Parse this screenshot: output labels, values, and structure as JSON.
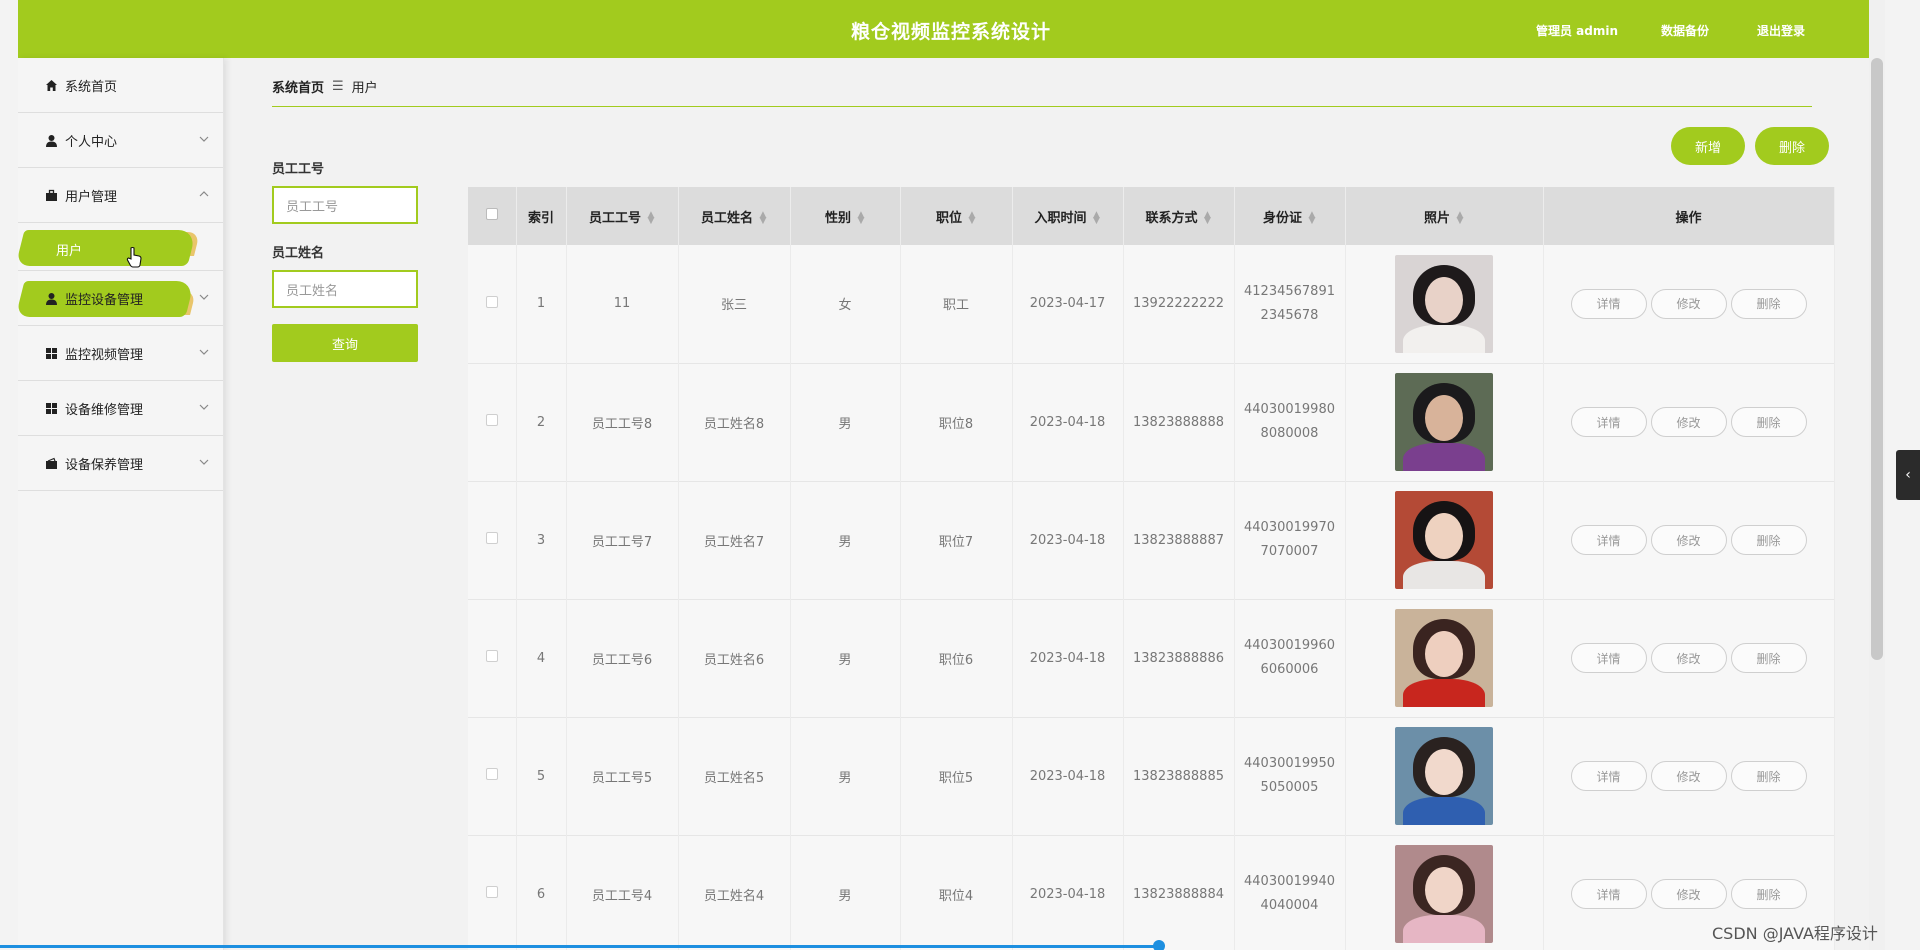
{
  "header": {
    "title": "粮仓视频监控系统设计",
    "user_label": "管理员 admin",
    "backup_label": "数据备份",
    "logout_label": "退出登录"
  },
  "sidebar": {
    "items": [
      {
        "label": "系统首页",
        "icon": "home-icon"
      },
      {
        "label": "个人中心",
        "icon": "user-icon"
      },
      {
        "label": "用户管理",
        "icon": "briefcase-icon"
      },
      {
        "label": "用户",
        "icon": ""
      },
      {
        "label": "监控设备管理",
        "icon": "user-icon"
      },
      {
        "label": "监控视频管理",
        "icon": "grid-icon"
      },
      {
        "label": "设备维修管理",
        "icon": "grid-icon"
      },
      {
        "label": "设备保养管理",
        "icon": "wallet-icon"
      }
    ]
  },
  "breadcrumb": {
    "home": "系统首页",
    "separator": "☰",
    "current": "用户"
  },
  "actions": {
    "add": "新增",
    "delete": "删除"
  },
  "filters": {
    "emp_no_label": "员工工号",
    "emp_no_placeholder": "员工工号",
    "emp_name_label": "员工姓名",
    "emp_name_placeholder": "员工姓名",
    "search": "查询"
  },
  "table": {
    "columns": [
      "索引",
      "员工工号",
      "员工姓名",
      "性别",
      "职位",
      "入职时间",
      "联系方式",
      "身份证",
      "照片",
      "操作"
    ],
    "rows": [
      {
        "index": "1",
        "emp_no": "11",
        "name": "张三",
        "gender": "女",
        "position": "职工",
        "hired": "2023-04-17",
        "phone": "13922222222",
        "id_line1": "41234567891",
        "id_line2": "2345678"
      },
      {
        "index": "2",
        "emp_no": "员工工号8",
        "name": "员工姓名8",
        "gender": "男",
        "position": "职位8",
        "hired": "2023-04-18",
        "phone": "13823888888",
        "id_line1": "44030019980",
        "id_line2": "8080008"
      },
      {
        "index": "3",
        "emp_no": "员工工号7",
        "name": "员工姓名7",
        "gender": "男",
        "position": "职位7",
        "hired": "2023-04-18",
        "phone": "13823888887",
        "id_line1": "44030019970",
        "id_line2": "7070007"
      },
      {
        "index": "4",
        "emp_no": "员工工号6",
        "name": "员工姓名6",
        "gender": "男",
        "position": "职位6",
        "hired": "2023-04-18",
        "phone": "13823888886",
        "id_line1": "44030019960",
        "id_line2": "6060006"
      },
      {
        "index": "5",
        "emp_no": "员工工号5",
        "name": "员工姓名5",
        "gender": "男",
        "position": "职位5",
        "hired": "2023-04-18",
        "phone": "13823888885",
        "id_line1": "44030019950",
        "id_line2": "5050005"
      },
      {
        "index": "6",
        "emp_no": "员工工号4",
        "name": "员工姓名4",
        "gender": "男",
        "position": "职位4",
        "hired": "2023-04-18",
        "phone": "13823888884",
        "id_line1": "44030019940",
        "id_line2": "4040004"
      }
    ],
    "row_actions": {
      "detail": "详情",
      "edit": "修改",
      "delete": "删除"
    }
  },
  "watermark": "CSDN @JAVA程序设计",
  "colors": {
    "accent": "#a2cb1e",
    "background": "#f2f2f2"
  }
}
